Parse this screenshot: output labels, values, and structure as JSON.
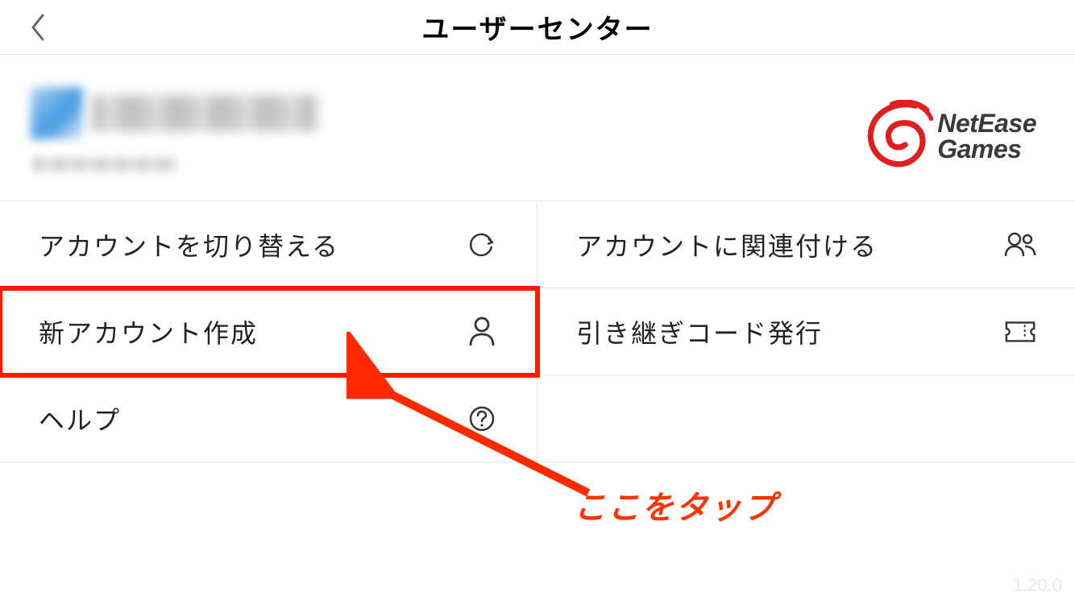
{
  "header": {
    "title": "ユーザーセンター"
  },
  "logo": {
    "line1": "NetEase",
    "line2": "Games"
  },
  "menu": {
    "switch_account": "アカウントを切り替える",
    "link_account": "アカウントに関連付ける",
    "new_account": "新アカウント作成",
    "transfer_code": "引き継ぎコード発行",
    "help": "ヘルプ"
  },
  "annotation": {
    "text": "ここをタップ"
  },
  "footer": {
    "version": "1.20.0"
  }
}
